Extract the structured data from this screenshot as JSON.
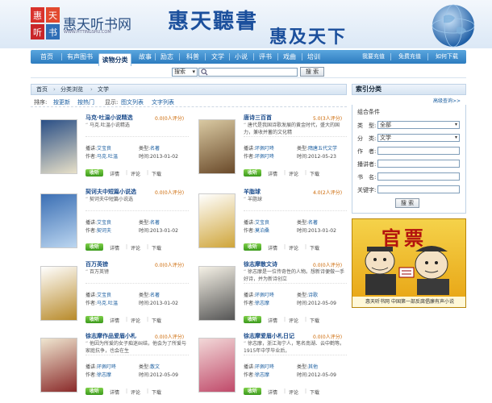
{
  "header": {
    "logo_text": "惠天听书网",
    "site_url": "WWW.HTTINGSHU.COM",
    "slogan_1": "惠天聽書",
    "slogan_2": "惠及天下"
  },
  "nav": {
    "items": [
      "首页",
      "有声图书",
      "读物分类",
      "故事",
      "励志",
      "科普",
      "文学",
      "小说",
      "评书",
      "戏曲",
      "培训"
    ],
    "right": [
      "我要充值",
      "免费充值",
      "如何下载"
    ],
    "active_index": 2
  },
  "search": {
    "select_value": "搜索",
    "button": "搜 索"
  },
  "breadcrumb": [
    "首页",
    "分类浏览",
    "文学"
  ],
  "sort": {
    "label": "排序:",
    "options": [
      "按更新",
      "按热门"
    ],
    "display_label": "显示:",
    "views": [
      "图文列表",
      "文字列表"
    ]
  },
  "labels": {
    "reader": "播讲:",
    "type": "类型:",
    "author": "作者:",
    "time": "时间:",
    "listen": "收听",
    "detail": "详情",
    "comment": "评论",
    "download": "下载"
  },
  "books": [
    {
      "title": "马克·吐温小说精选",
      "rating": "0.0(0人评分)",
      "desc": "马克.吐温小说精选",
      "reader": "艾宝良",
      "type": "名著",
      "author": "马克.吐温",
      "time": "2013-01-02"
    },
    {
      "title": "唐诗三百首",
      "rating": "5.0(3人评分)",
      "desc": "唐代是我国诗歌发展的黄金时代，盛大的国力，兼收并蓄的文化精",
      "reader": "环佩叮咚",
      "type": "隋唐五代文学",
      "author": "环佩叮咚",
      "time": "2012-05-23"
    },
    {
      "title": "契诃夫中短篇小说选",
      "rating": "0.0(0人评分)",
      "desc": "契诃夫中短篇小说选",
      "reader": "艾宝良",
      "type": "名著",
      "author": "契诃夫",
      "time": "2013-01-02"
    },
    {
      "title": "羊脂球",
      "rating": "4.0(2人评分)",
      "desc": "羊脂球",
      "reader": "艾宝良",
      "type": "名著",
      "author": "莫泊桑",
      "time": "2013-01-02"
    },
    {
      "title": "百万英镑",
      "rating": "0.0(0人评分)",
      "desc": "百万英镑",
      "reader": "艾宝良",
      "type": "名著",
      "author": "马克.吐温",
      "time": "2013-01-02"
    },
    {
      "title": "徐志摩散文诗",
      "rating": "0.0(0人评分)",
      "desc": "徐志摩是一位传奇性的人物。想新诗便做一手好诗，并为新诗创立",
      "reader": "环佩叮咚",
      "type": "诗歌",
      "author": "徐志摩",
      "time": "2012-05-09"
    },
    {
      "title": "徐志摩作品爱眉小札",
      "rating": "0.0(0人评分)",
      "desc": "他因为所爱的女子痴迷纠结，他会为了所爱与家庭抗争，也会在生",
      "reader": "环佩叮咚",
      "type": "散文",
      "author": "徐志摩",
      "time": "2012-05-09"
    },
    {
      "title": "徐志摩爱眉小札日记",
      "rating": "0.0(0人评分)",
      "desc": "徐志摩，浙江海宁人，笔名南湖、云中鹤等。1915年中学毕业后，",
      "reader": "环佩叮咚",
      "type": "其他",
      "author": "徐志摩",
      "time": "2012-05-09"
    }
  ],
  "sidebar": {
    "title": "索引分类",
    "advanced": "高级查询>>",
    "group_label": "组合条件",
    "fields": [
      {
        "label": "类　型:",
        "value": "全部"
      },
      {
        "label": "分　类:",
        "value": "文学"
      },
      {
        "label": "作　者:",
        "value": ""
      },
      {
        "label": "播讲者:",
        "value": ""
      },
      {
        "label": "书　名:",
        "value": ""
      },
      {
        "label": "关键字:",
        "value": ""
      }
    ],
    "button": "搜 索"
  },
  "ad": {
    "title": "官票",
    "caption": "惠天听书网 中国第一部反腐倡廉有声小说"
  },
  "colors": {
    "nav": "#2d7cc0",
    "link": "#1b5ea0",
    "title": "#1b4c8c",
    "listen": "#3b9a1c"
  }
}
